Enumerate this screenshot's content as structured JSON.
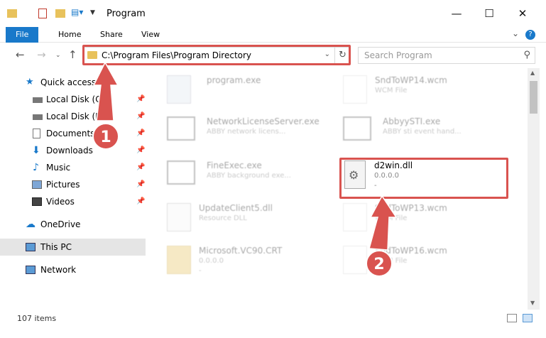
{
  "window": {
    "title": "Program"
  },
  "ribbon": {
    "tabs": [
      "File",
      "Home",
      "Share",
      "View"
    ]
  },
  "address": {
    "path": "C:\\Program Files\\Program Directory"
  },
  "search": {
    "placeholder": "Search Program"
  },
  "nav": [
    {
      "label": "Quick access"
    },
    {
      "label": "Local Disk (C:)"
    },
    {
      "label": "Local Disk (D:)"
    },
    {
      "label": "Documents"
    },
    {
      "label": "Downloads"
    },
    {
      "label": "Music"
    },
    {
      "label": "Pictures"
    },
    {
      "label": "Videos"
    },
    {
      "label": "OneDrive"
    },
    {
      "label": "This PC"
    },
    {
      "label": "Network"
    }
  ],
  "files": [
    {
      "name": "program.exe",
      "sub": "",
      "sub2": ""
    },
    {
      "name": "SndToWP14.wcm",
      "sub": "WCM File",
      "sub2": ""
    },
    {
      "name": "NetworkLicenseServer.exe",
      "sub": "ABBY network licens...",
      "sub2": ""
    },
    {
      "name": "AbbyySTI.exe",
      "sub": "ABBY sti event hand...",
      "sub2": ""
    },
    {
      "name": "FineExec.exe",
      "sub": "ABBY background exe...",
      "sub2": ""
    },
    {
      "name": "d2win.dll",
      "sub": "0.0.0.0",
      "sub2": "-"
    },
    {
      "name": "UpdateClient5.dll",
      "sub": "Resource DLL",
      "sub2": ""
    },
    {
      "name": "SndToWP13.wcm",
      "sub": "WCM File",
      "sub2": ""
    },
    {
      "name": "Microsoft.VC90.CRT",
      "sub": "0.0.0.0",
      "sub2": "-"
    },
    {
      "name": "SndToWP16.wcm",
      "sub": "WCM File",
      "sub2": ""
    }
  ],
  "status": {
    "items": "107 items"
  },
  "markers": {
    "one": "1",
    "two": "2"
  }
}
